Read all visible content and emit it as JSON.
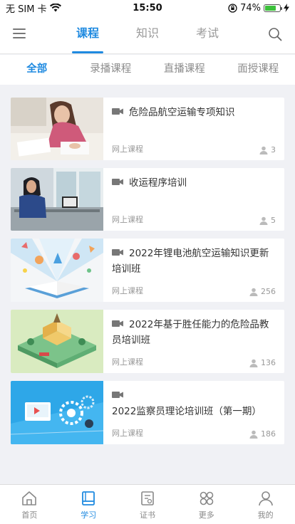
{
  "status": {
    "carrier": "无 SIM 卡",
    "time": "15:50",
    "battery": "74%",
    "battery_level": 0.74
  },
  "header": {
    "tabs": [
      {
        "label": "课程",
        "active": true
      },
      {
        "label": "知识",
        "active": false
      },
      {
        "label": "考试",
        "active": false
      }
    ],
    "menu_icon": "hamburger-icon",
    "search_icon": "search-icon"
  },
  "filters": [
    {
      "label": "全部",
      "active": true
    },
    {
      "label": "录播课程",
      "active": false
    },
    {
      "label": "直播课程",
      "active": false
    },
    {
      "label": "面授课程",
      "active": false
    }
  ],
  "courses": [
    {
      "title": "危险品航空运输专项知识",
      "type": "网上课程",
      "count": "3",
      "thumb": "person-writing-photo"
    },
    {
      "title": "收运程序培训",
      "type": "网上课程",
      "count": "5",
      "thumb": "person-at-desk-photo"
    },
    {
      "title": "2022年锂电池航空运输知识更新培训班",
      "type": "网上课程",
      "count": "256",
      "thumb": "open-book-illustration"
    },
    {
      "title": "2022年基于胜任能力的危险品教员培训班",
      "type": "网上课程",
      "count": "136",
      "thumb": "isometric-school-illustration"
    },
    {
      "title": "2022监察员理论培训班（第一期）",
      "type": "网上课程",
      "count": "186",
      "thumb": "gears-screen-illustration"
    }
  ],
  "tabbar": [
    {
      "label": "首页",
      "icon": "home-icon",
      "active": false
    },
    {
      "label": "学习",
      "icon": "book-icon",
      "active": true
    },
    {
      "label": "证书",
      "icon": "certificate-icon",
      "active": false
    },
    {
      "label": "更多",
      "icon": "grid-icon",
      "active": false
    },
    {
      "label": "我的",
      "icon": "user-icon",
      "active": false
    }
  ],
  "colors": {
    "accent": "#1f8ae0",
    "muted": "#999999",
    "background": "#f0f1f5"
  }
}
